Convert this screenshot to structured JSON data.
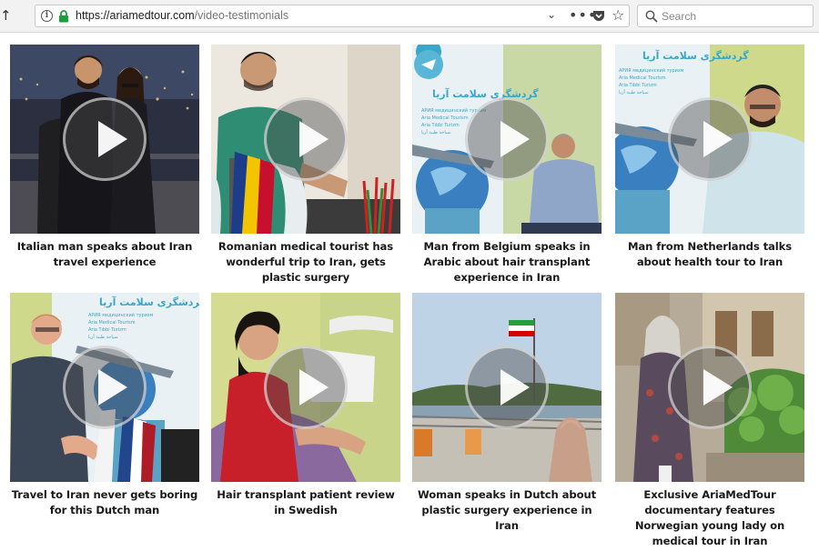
{
  "browser": {
    "url_host": "https://ariamedtour.com",
    "url_path": "/video-testimonials",
    "search_placeholder": "Search"
  },
  "videos": [
    {
      "caption": "Italian man speaks about Iran travel experience",
      "thumbnail": "couple-city-night"
    },
    {
      "caption": "Romanian medical tourist has wonderful trip to Iran, gets plastic surgery",
      "thumbnail": "man-green-shirt-romanian-flag"
    },
    {
      "caption": "Man from Belgium speaks in Arabic about hair transplant experience in Iran",
      "thumbnail": "man-by-aria-banner"
    },
    {
      "caption": "Man from Netherlands talks about health tour to Iran",
      "thumbnail": "man-glasses-by-aria-banner"
    },
    {
      "caption": "Travel to Iran never gets boring for this Dutch man",
      "thumbnail": "man-glasses-dutch-flag"
    },
    {
      "caption": "Hair transplant patient review in Swedish",
      "thumbnail": "woman-dental-chair"
    },
    {
      "caption": "Woman speaks in Dutch about plastic surgery experience in Iran",
      "thumbnail": "woman-hijab-seaside"
    },
    {
      "caption": "Exclusive AriaMedTour documentary features Norwegian young lady on medical tour in Iran",
      "thumbnail": "woman-scarf-garden"
    }
  ],
  "banner_text": {
    "title_fa": "گردشگری سلامت آریا",
    "line_ru": "АРИЯ медицинский туризм",
    "line_en": "Aria Medical Tourism",
    "line_tr": "Aria Tıbbi Turizm",
    "line_ar": "سیاحة طبیة آریا"
  }
}
